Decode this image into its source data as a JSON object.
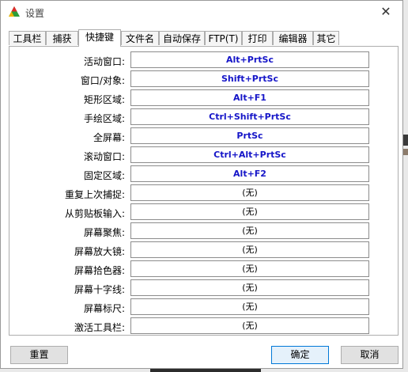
{
  "window": {
    "title": "设置",
    "close_symbol": "✕"
  },
  "tabs": [
    {
      "label": "工具栏"
    },
    {
      "label": "捕获"
    },
    {
      "label": "快捷键"
    },
    {
      "label": "文件名"
    },
    {
      "label": "自动保存"
    },
    {
      "label": "FTP(T)"
    },
    {
      "label": "打印"
    },
    {
      "label": "编辑器"
    },
    {
      "label": "其它"
    }
  ],
  "active_tab": "快捷键",
  "hotkeys": [
    {
      "label": "活动窗口:",
      "value": "Alt+PrtSc"
    },
    {
      "label": "窗口/对象:",
      "value": "Shift+PrtSc"
    },
    {
      "label": "矩形区域:",
      "value": "Alt+F1"
    },
    {
      "label": "手绘区域:",
      "value": "Ctrl+Shift+PrtSc"
    },
    {
      "label": "全屏幕:",
      "value": "PrtSc"
    },
    {
      "label": "滚动窗口:",
      "value": "Ctrl+Alt+PrtSc"
    },
    {
      "label": "固定区域:",
      "value": "Alt+F2"
    },
    {
      "label": "重复上次捕捉:",
      "value": "(无)"
    },
    {
      "label": "从剪贴板输入:",
      "value": "(无)"
    },
    {
      "label": "屏幕聚焦:",
      "value": "(无)"
    },
    {
      "label": "屏幕放大镜:",
      "value": "(无)"
    },
    {
      "label": "屏幕拾色器:",
      "value": "(无)"
    },
    {
      "label": "屏幕十字线:",
      "value": "(无)"
    },
    {
      "label": "屏幕标尺:",
      "value": "(无)"
    },
    {
      "label": "激活工具栏:",
      "value": "(无)"
    }
  ],
  "buttons": {
    "reset": "重置",
    "ok": "确定",
    "cancel": "取消"
  },
  "colors": {
    "hotkey_set": "#1515c8",
    "default_button_border": "#0078d7"
  }
}
